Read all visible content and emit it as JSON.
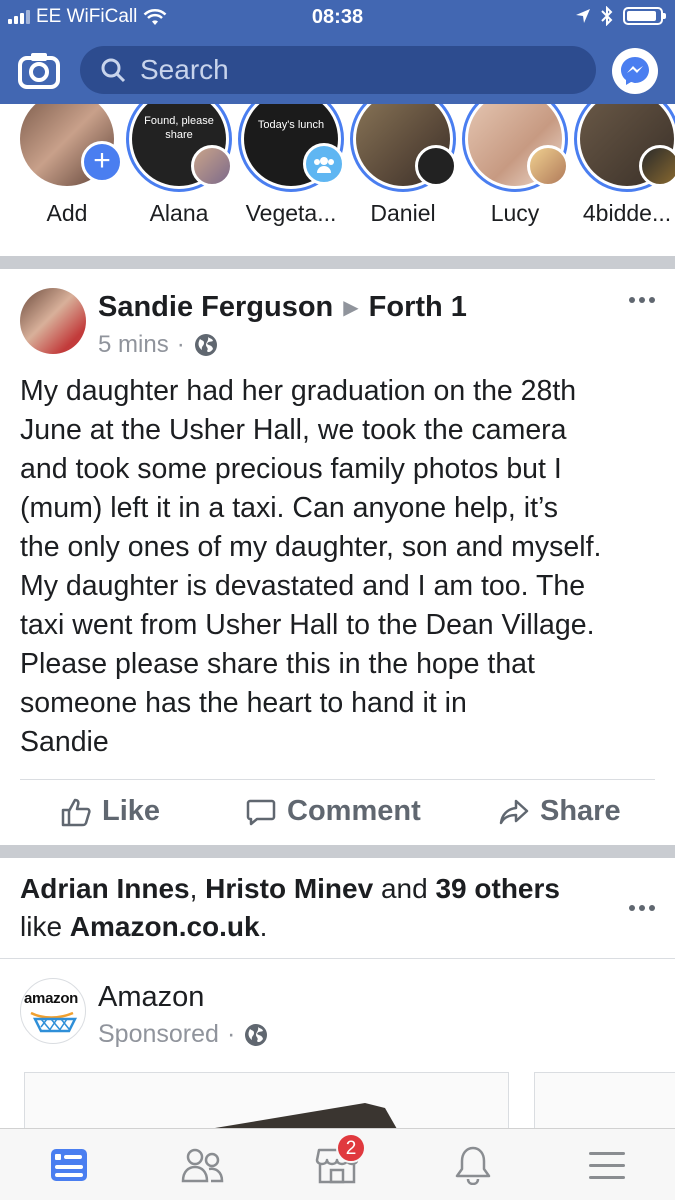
{
  "status_bar": {
    "carrier": "EE WiFiCall",
    "time": "08:38"
  },
  "header": {
    "search_placeholder": "Search",
    "colors": {
      "brand": "#4267b2",
      "search_bg": "#2d4c8f"
    }
  },
  "stories": [
    {
      "label": "Add",
      "icon": "plus-icon"
    },
    {
      "label": "Alana",
      "text": "Found, please share"
    },
    {
      "label": "Vegeta...",
      "text": "Today's lunch",
      "icon": "group-icon"
    },
    {
      "label": "Daniel"
    },
    {
      "label": "Lucy"
    },
    {
      "label": "4bidde..."
    }
  ],
  "post": {
    "author": "Sandie Ferguson",
    "group": "Forth 1",
    "time": "5 mins",
    "separator": "·",
    "privacy_icon": "globe-icon",
    "text": "My daughter had her graduation on the 28th\nJune at the Usher Hall, we took the camera\nand took some precious family photos but I\n(mum) left it in a taxi. Can anyone help, it’s\nthe only ones of my daughter, son and myself.\nMy daughter is devastated and I am too.   The\ntaxi went from Usher Hall to the Dean Village.\nPlease please share this in the hope that\nsomeone has the heart to hand it in\nSandie",
    "actions": {
      "like": "Like",
      "comment": "Comment",
      "share": "Share"
    }
  },
  "sponsored_post": {
    "liker_1": "Adrian Innes",
    "separator": ", ",
    "liker_2": "Hristo Minev",
    "and_text": " and ",
    "others": "39 others",
    "like_text": "like ",
    "page": "Amazon.co.uk",
    "period": ".",
    "advertiser": "Amazon",
    "logo_text": "amazon",
    "sponsored_label": "Sponsored",
    "separator_dot": "·"
  },
  "tab_bar": {
    "tabs": [
      {
        "icon": "news-feed-icon",
        "active": true
      },
      {
        "icon": "friends-icon"
      },
      {
        "icon": "marketplace-icon",
        "badge": "2"
      },
      {
        "icon": "notifications-icon"
      },
      {
        "icon": "menu-icon"
      }
    ]
  }
}
